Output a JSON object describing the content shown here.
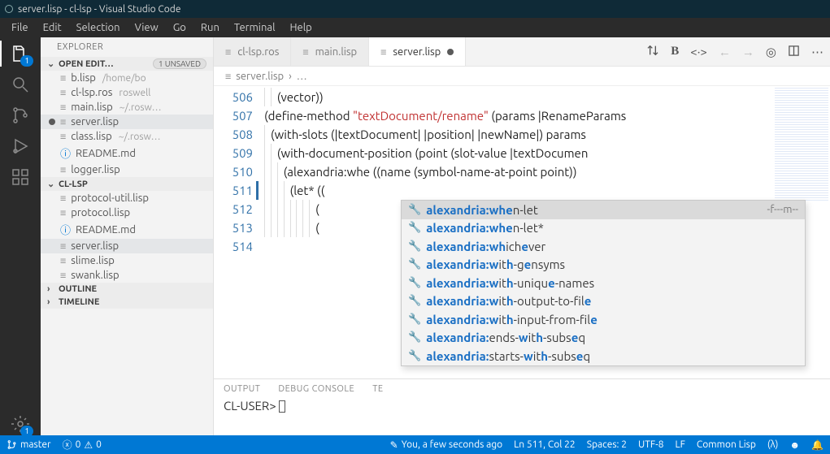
{
  "window_title": "server.lisp - cl-lsp - Visual Studio Code",
  "menu": [
    "File",
    "Edit",
    "Selection",
    "View",
    "Go",
    "Run",
    "Terminal",
    "Help"
  ],
  "activity": {
    "badge_files": "1",
    "badge_gear": "1"
  },
  "sidebar": {
    "title": "EXPLORER",
    "open_editors_label": "OPEN EDIT…",
    "unsaved_badge": "1 UNSAVED",
    "open_editors": [
      {
        "name": "b.lisp",
        "hint": "/home/bo",
        "dirty": false
      },
      {
        "name": "cl-lsp.ros",
        "hint": "roswell",
        "dirty": false
      },
      {
        "name": "main.lisp",
        "hint": "~/.rosw…",
        "dirty": false
      },
      {
        "name": "server.lisp",
        "hint": "",
        "dirty": true,
        "active": true
      },
      {
        "name": "class.lisp",
        "hint": "~/.rosw…",
        "dirty": false
      },
      {
        "name": "README.md",
        "hint": "",
        "dirty": false,
        "info": true
      },
      {
        "name": "logger.lisp",
        "hint": "",
        "dirty": false
      }
    ],
    "folder_label": "CL-LSP",
    "folder_files": [
      {
        "name": "protocol-util.lisp"
      },
      {
        "name": "protocol.lisp"
      },
      {
        "name": "README.md",
        "info": true
      },
      {
        "name": "server.lisp",
        "active": true
      },
      {
        "name": "slime.lisp"
      },
      {
        "name": "swank.lisp"
      }
    ],
    "outline_label": "OUTLINE",
    "timeline_label": "TIMELINE"
  },
  "tabs": [
    {
      "label": "cl-lsp.ros"
    },
    {
      "label": "main.lisp"
    },
    {
      "label": "server.lisp",
      "active": true,
      "dirty": true
    }
  ],
  "breadcrumb": {
    "file": "server.lisp",
    "sep": "›",
    "more": "…"
  },
  "code": {
    "lines": [
      {
        "n": 506,
        "pre": "   ",
        "txt": "(vector))"
      },
      {
        "n": 507,
        "pre": "",
        "txt": ""
      },
      {
        "n": 508,
        "pre": "",
        "txt": "(define-method ",
        "str": "\"textDocument/rename\"",
        "rest": " (params |RenameParams"
      },
      {
        "n": 509,
        "pre": "  ",
        "txt": "(with-slots (|textDocument| |position| |newName|) params"
      },
      {
        "n": 510,
        "pre": "    ",
        "txt": "(with-document-position (point (slot-value |textDocumen"
      },
      {
        "n": 511,
        "pre": "      ",
        "txt": "(alexandria:whe ((name (symbol-name-at-point point))",
        "cursor": true
      },
      {
        "n": 512,
        "pre": "        ",
        "txt": "(let* (("
      },
      {
        "n": 513,
        "pre": "               ",
        "txt": "("
      },
      {
        "n": 514,
        "pre": "               ",
        "txt": "("
      }
    ]
  },
  "autocomplete": {
    "meta": "-f---m--",
    "items": [
      {
        "parts": [
          [
            "alexandria:whe",
            1
          ],
          [
            "n-let",
            0
          ]
        ],
        "sel": true
      },
      {
        "parts": [
          [
            "alexandria:whe",
            1
          ],
          [
            "n-let*",
            0
          ]
        ]
      },
      {
        "parts": [
          [
            "alexandria:wh",
            1
          ],
          [
            "ich",
            0
          ],
          [
            "e",
            1
          ],
          [
            "ver",
            0
          ]
        ]
      },
      {
        "parts": [
          [
            "alexandria:w",
            1
          ],
          [
            "it",
            0
          ],
          [
            "h",
            1
          ],
          [
            "-g",
            0
          ],
          [
            "e",
            1
          ],
          [
            "nsyms",
            0
          ]
        ]
      },
      {
        "parts": [
          [
            "alexandria:w",
            1
          ],
          [
            "it",
            0
          ],
          [
            "h",
            1
          ],
          [
            "-uniqu",
            0
          ],
          [
            "e",
            1
          ],
          [
            "-names",
            0
          ]
        ]
      },
      {
        "parts": [
          [
            "alexandria:w",
            1
          ],
          [
            "it",
            0
          ],
          [
            "h",
            1
          ],
          [
            "-output-to-fil",
            0
          ],
          [
            "e",
            1
          ]
        ]
      },
      {
        "parts": [
          [
            "alexandria:w",
            1
          ],
          [
            "it",
            0
          ],
          [
            "h",
            1
          ],
          [
            "-input-from-fil",
            0
          ],
          [
            "e",
            1
          ]
        ]
      },
      {
        "parts": [
          [
            "alexandria:",
            1
          ],
          [
            "ends-",
            0
          ],
          [
            "w",
            1
          ],
          [
            "it",
            0
          ],
          [
            "h",
            1
          ],
          [
            "-subs",
            0
          ],
          [
            "e",
            1
          ],
          [
            "q",
            0
          ]
        ]
      },
      {
        "parts": [
          [
            "alexandria:",
            1
          ],
          [
            "starts-",
            0
          ],
          [
            "w",
            1
          ],
          [
            "it",
            0
          ],
          [
            "h",
            1
          ],
          [
            "-subs",
            0
          ],
          [
            "e",
            1
          ],
          [
            "q",
            0
          ]
        ]
      }
    ]
  },
  "panel": {
    "tabs": [
      "OUTPUT",
      "DEBUG CONSOLE",
      "TE"
    ],
    "prompt": "CL-USER> "
  },
  "status": {
    "branch": "master",
    "errors": "0",
    "warnings": "0",
    "blame": "You, a few seconds ago",
    "pos": "Ln 511, Col 22",
    "spaces": "Spaces: 2",
    "enc": "UTF-8",
    "eol": "LF",
    "lang": "Common Lisp",
    "lambda": "(λ)",
    "bell": "",
    "misc": ""
  }
}
